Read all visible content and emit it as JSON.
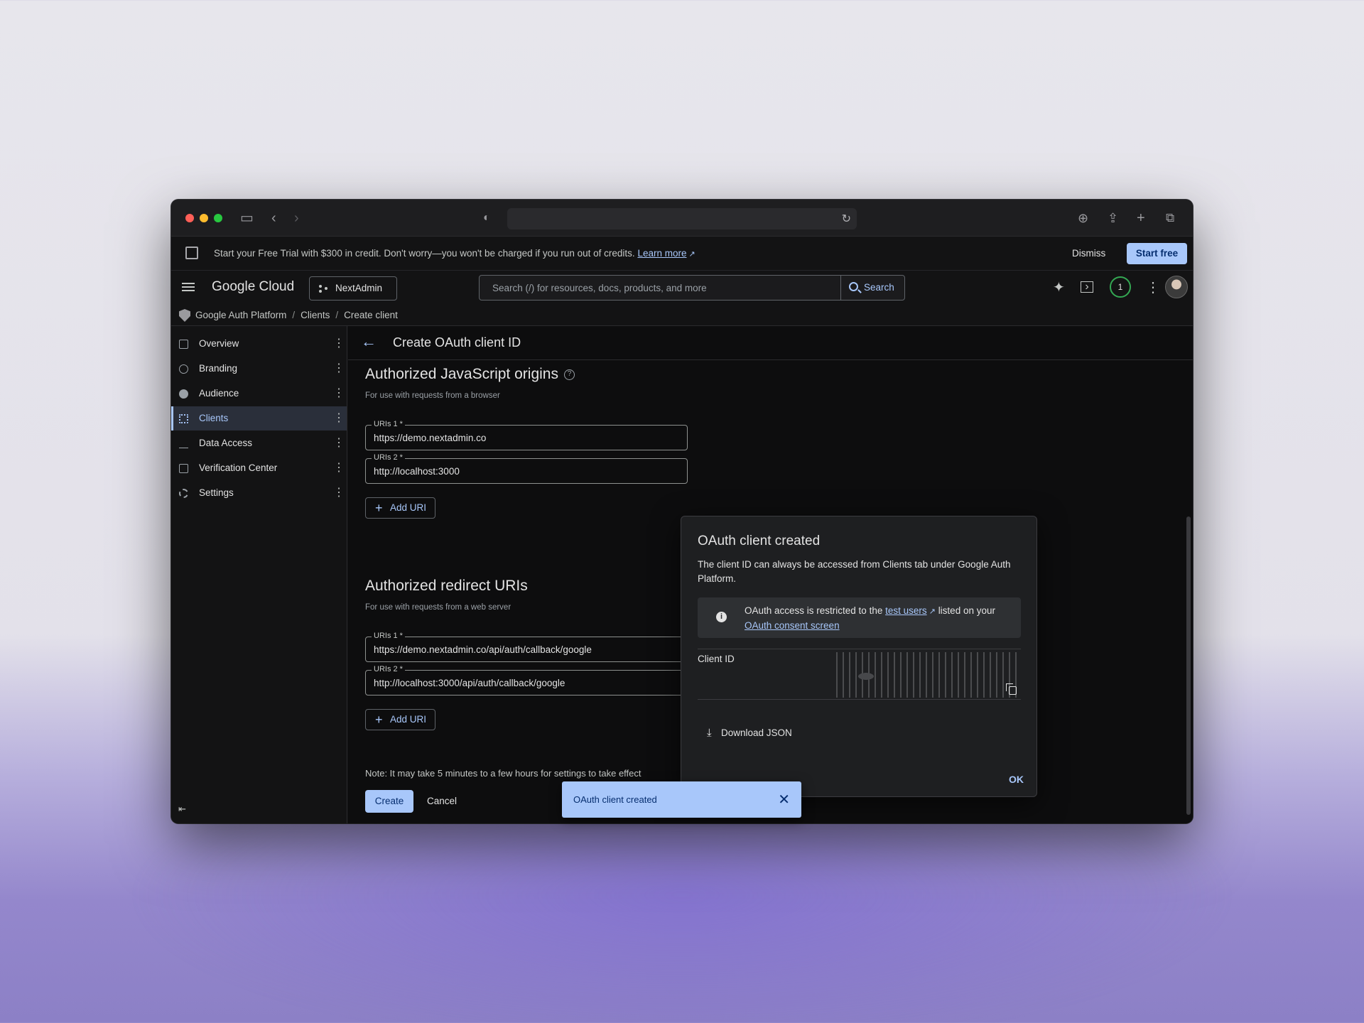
{
  "banner": {
    "message": "Start your Free Trial with $300 in credit. Don't worry—you won't be charged if you run out of credits.",
    "learn_more": "Learn more",
    "dismiss": "Dismiss",
    "start_free": "Start free"
  },
  "header": {
    "logo": "Google Cloud",
    "project": "NextAdmin",
    "search_placeholder": "Search (/) for resources, docs, products, and more",
    "search_button": "Search",
    "notification_count": "1"
  },
  "breadcrumb": [
    "Google Auth Platform",
    "Clients",
    "Create client"
  ],
  "sidebar": {
    "items": [
      {
        "label": "Overview",
        "icon": "dashboard-icon"
      },
      {
        "label": "Branding",
        "icon": "palette-icon"
      },
      {
        "label": "Audience",
        "icon": "account-circle-icon"
      },
      {
        "label": "Clients",
        "icon": "grid-icon",
        "active": true
      },
      {
        "label": "Data Access",
        "icon": "data-access-icon"
      },
      {
        "label": "Verification Center",
        "icon": "checklist-icon"
      },
      {
        "label": "Settings",
        "icon": "gear-icon"
      }
    ]
  },
  "page": {
    "title": "Create OAuth client ID",
    "js_origins": {
      "title": "Authorized JavaScript origins",
      "subtitle": "For use with requests from a browser",
      "uris": [
        {
          "label": "URIs 1 *",
          "value": "https://demo.nextadmin.co"
        },
        {
          "label": "URIs 2 *",
          "value": "http://localhost:3000"
        }
      ],
      "add_uri": "Add URI"
    },
    "redirect": {
      "title": "Authorized redirect URIs",
      "subtitle": "For use with requests from a web server",
      "uris": [
        {
          "label": "URIs 1 *",
          "value": "https://demo.nextadmin.co/api/auth/callback/google"
        },
        {
          "label": "URIs 2 *",
          "value": "http://localhost:3000/api/auth/callback/google"
        }
      ],
      "add_uri": "Add URI"
    },
    "note": "Note: It may take 5 minutes to a few hours for settings to take effect",
    "create": "Create",
    "cancel": "Cancel"
  },
  "dialog": {
    "title": "OAuth client created",
    "body": "The client ID can always be accessed from Clients tab under Google Auth Platform.",
    "info_pre": "OAuth access is restricted to the",
    "info_link1": "test users",
    "info_mid": "listed on your",
    "info_link2": "OAuth consent screen",
    "client_id_label": "Client ID",
    "download": "Download JSON",
    "ok": "OK"
  },
  "snackbar": {
    "message": "OAuth client created"
  },
  "colors": {
    "accent": "#a8c7fa",
    "background": "#0d0d0e"
  }
}
